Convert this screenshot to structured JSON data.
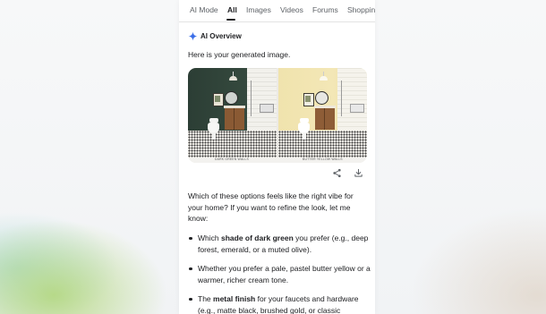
{
  "tabs": [
    {
      "label": "AI Mode"
    },
    {
      "label": "All",
      "active": true
    },
    {
      "label": "Images"
    },
    {
      "label": "Videos"
    },
    {
      "label": "Forums"
    },
    {
      "label": "Shopping"
    }
  ],
  "overview": {
    "title": "AI Overview",
    "intro": "Here is your generated image.",
    "image": {
      "left_caption": "DARK GREEN WALLS",
      "right_caption": "BUTTER YELLOW WALLS"
    },
    "actions": {
      "share_icon": "share-icon",
      "download_icon": "download-icon"
    },
    "question": "Which of these options feels like the right vibe for your home? If you want to refine the look, let me know:",
    "bullets": [
      {
        "pre": "Which ",
        "bold": "shade of dark green",
        "post": " you prefer (e.g., deep forest, emerald, or a muted olive)."
      },
      {
        "pre": "Whether you prefer a pale, pastel butter yellow or a warmer, richer cream tone.",
        "bold": "",
        "post": ""
      },
      {
        "pre": "The ",
        "bold": "metal finish",
        "post": " for your faucets and hardware (e.g., matte black, brushed gold, or classic"
      }
    ]
  },
  "colors": {
    "sparkle": "#3b6ee8",
    "dark_green_wall": "#2f4238",
    "butter_yellow_wall": "#efe0a6"
  }
}
